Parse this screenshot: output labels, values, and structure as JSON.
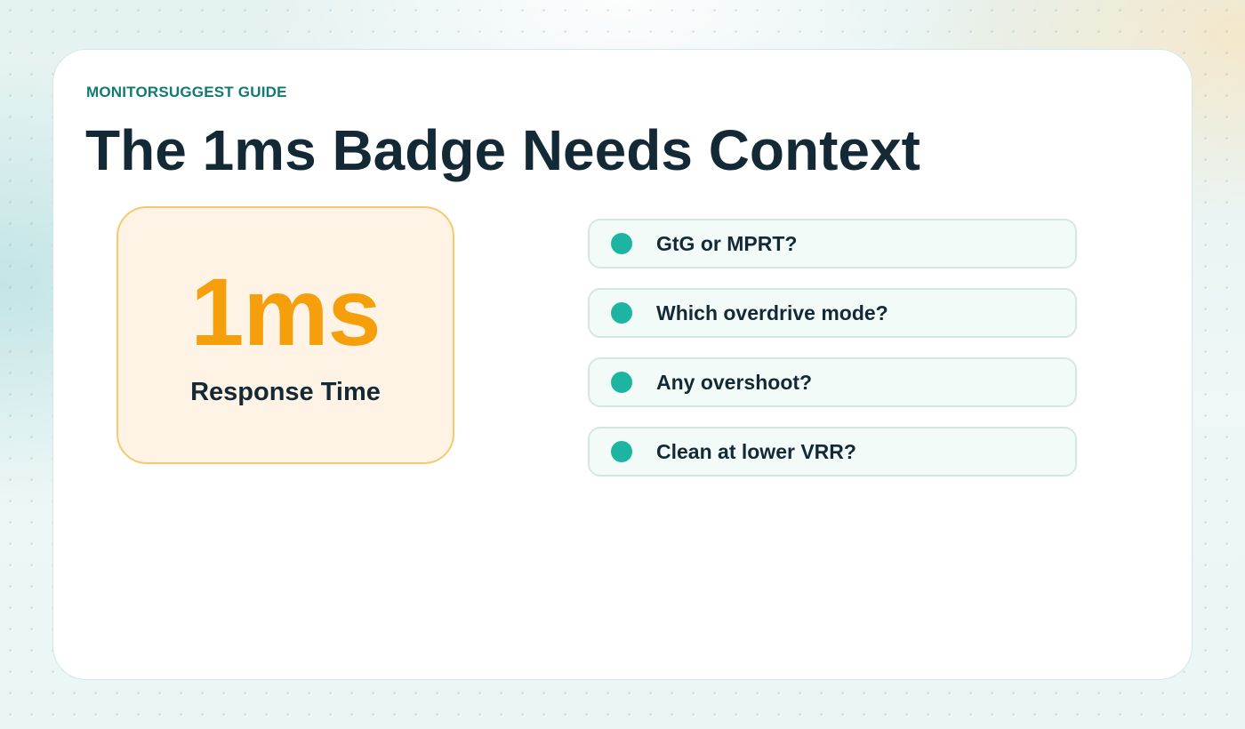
{
  "header": {
    "eyebrow": "MONITORSUGGEST GUIDE",
    "title": "The 1ms Badge Needs Context"
  },
  "badge": {
    "value": "1ms",
    "label": "Response Time"
  },
  "questions": [
    {
      "label": "GtG or MPRT?"
    },
    {
      "label": "Which overdrive mode?"
    },
    {
      "label": "Any overshoot?"
    },
    {
      "label": "Clean at lower VRR?"
    }
  ],
  "colors": {
    "accent_teal": "#1eb4a2",
    "eyebrow_teal": "#117a72",
    "badge_orange": "#f59f0c",
    "badge_border": "#f6c970",
    "badge_fill": "#fef3e5",
    "title_navy": "#132a36"
  },
  "icons": {
    "question_bullet": "teal-dot-icon"
  }
}
